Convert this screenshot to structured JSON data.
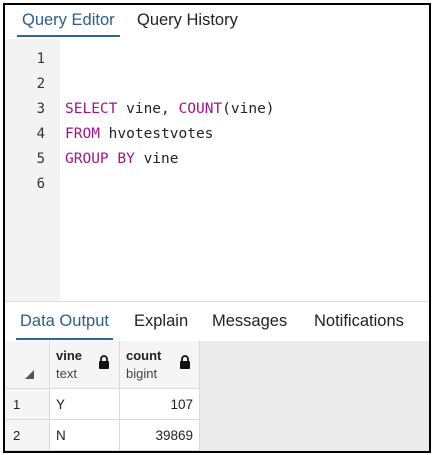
{
  "top_tabs": [
    {
      "label": "Query Editor",
      "active": true
    },
    {
      "label": "Query History",
      "active": false
    }
  ],
  "editor": {
    "line_numbers": [
      "1",
      "2",
      "3",
      "4",
      "5",
      "6"
    ],
    "lines": [
      {
        "kw1": "",
        "text1": "",
        "kw2": "",
        "text2": ""
      },
      {
        "kw1": "",
        "text1": "",
        "kw2": "",
        "text2": ""
      },
      {
        "kw1": "SELECT",
        "text1": " vine, ",
        "kw2": "COUNT",
        "text2": "(vine)"
      },
      {
        "kw1": "FROM",
        "text1": " hvotestvotes",
        "kw2": "",
        "text2": ""
      },
      {
        "kw1": "GROUP BY",
        "text1": " vine",
        "kw2": "",
        "text2": ""
      },
      {
        "kw1": "",
        "text1": "",
        "kw2": "",
        "text2": ""
      }
    ]
  },
  "bottom_tabs": [
    {
      "label": "Data Output",
      "active": true
    },
    {
      "label": "Explain",
      "active": false
    },
    {
      "label": "Messages",
      "active": false
    },
    {
      "label": "Notifications",
      "active": false
    }
  ],
  "grid": {
    "columns": [
      {
        "name": "vine",
        "type": "text",
        "icon": "lock-icon"
      },
      {
        "name": "count",
        "type": "bigint",
        "icon": "lock-icon"
      }
    ],
    "rows": [
      {
        "num": "1",
        "vine": "Y",
        "count": "107"
      },
      {
        "num": "2",
        "vine": "N",
        "count": "39869"
      }
    ]
  },
  "colors": {
    "keyword": "#a01585",
    "active_tab": "#326690",
    "gutter": "#f3f3f3",
    "grid_empty": "#ebebeb"
  }
}
